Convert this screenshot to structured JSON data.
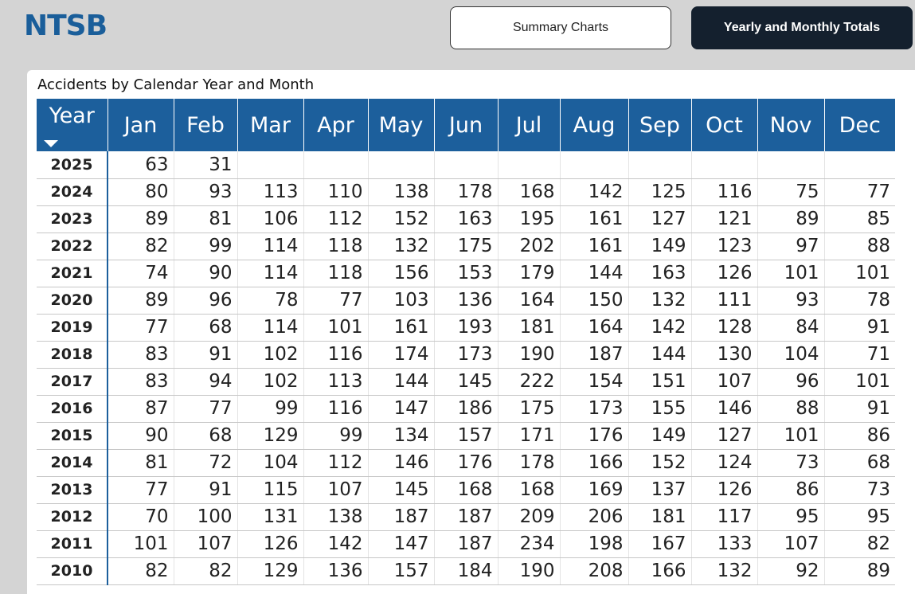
{
  "header": {
    "logo": "NTSB",
    "nav": [
      {
        "label": "Summary Charts",
        "active": false
      },
      {
        "label": "Yearly and Monthly Totals",
        "active": true
      }
    ]
  },
  "table": {
    "title": "Accidents by Calendar Year and Month",
    "sort": "descending",
    "columns": [
      "Year",
      "Jan",
      "Feb",
      "Mar",
      "Apr",
      "May",
      "Jun",
      "Jul",
      "Aug",
      "Sep",
      "Oct",
      "Nov",
      "Dec"
    ],
    "rows": [
      {
        "year": "2025",
        "values": [
          "63",
          "31",
          "",
          "",
          "",
          "",
          "",
          "",
          "",
          "",
          "",
          ""
        ]
      },
      {
        "year": "2024",
        "values": [
          "80",
          "93",
          "113",
          "110",
          "138",
          "178",
          "168",
          "142",
          "125",
          "116",
          "75",
          "77"
        ]
      },
      {
        "year": "2023",
        "values": [
          "89",
          "81",
          "106",
          "112",
          "152",
          "163",
          "195",
          "161",
          "127",
          "121",
          "89",
          "85"
        ]
      },
      {
        "year": "2022",
        "values": [
          "82",
          "99",
          "114",
          "118",
          "132",
          "175",
          "202",
          "161",
          "149",
          "123",
          "97",
          "88"
        ]
      },
      {
        "year": "2021",
        "values": [
          "74",
          "90",
          "114",
          "118",
          "156",
          "153",
          "179",
          "144",
          "163",
          "126",
          "101",
          "101"
        ]
      },
      {
        "year": "2020",
        "values": [
          "89",
          "96",
          "78",
          "77",
          "103",
          "136",
          "164",
          "150",
          "132",
          "111",
          "93",
          "78"
        ]
      },
      {
        "year": "2019",
        "values": [
          "77",
          "68",
          "114",
          "101",
          "161",
          "193",
          "181",
          "164",
          "142",
          "128",
          "84",
          "91"
        ]
      },
      {
        "year": "2018",
        "values": [
          "83",
          "91",
          "102",
          "116",
          "174",
          "173",
          "190",
          "187",
          "144",
          "130",
          "104",
          "71"
        ]
      },
      {
        "year": "2017",
        "values": [
          "83",
          "94",
          "102",
          "113",
          "144",
          "145",
          "222",
          "154",
          "151",
          "107",
          "96",
          "101"
        ]
      },
      {
        "year": "2016",
        "values": [
          "87",
          "77",
          "99",
          "116",
          "147",
          "186",
          "175",
          "173",
          "155",
          "146",
          "88",
          "91"
        ]
      },
      {
        "year": "2015",
        "values": [
          "90",
          "68",
          "129",
          "99",
          "134",
          "157",
          "171",
          "176",
          "149",
          "127",
          "101",
          "86"
        ]
      },
      {
        "year": "2014",
        "values": [
          "81",
          "72",
          "104",
          "112",
          "146",
          "176",
          "178",
          "166",
          "152",
          "124",
          "73",
          "68"
        ]
      },
      {
        "year": "2013",
        "values": [
          "77",
          "91",
          "115",
          "107",
          "145",
          "168",
          "168",
          "169",
          "137",
          "126",
          "86",
          "73"
        ]
      },
      {
        "year": "2012",
        "values": [
          "70",
          "100",
          "131",
          "138",
          "187",
          "187",
          "209",
          "206",
          "181",
          "117",
          "95",
          "95"
        ]
      },
      {
        "year": "2011",
        "values": [
          "101",
          "107",
          "126",
          "142",
          "147",
          "187",
          "234",
          "198",
          "167",
          "133",
          "107",
          "82"
        ]
      },
      {
        "year": "2010",
        "values": [
          "82",
          "82",
          "129",
          "136",
          "157",
          "184",
          "190",
          "208",
          "166",
          "132",
          "92",
          "89"
        ]
      }
    ]
  }
}
